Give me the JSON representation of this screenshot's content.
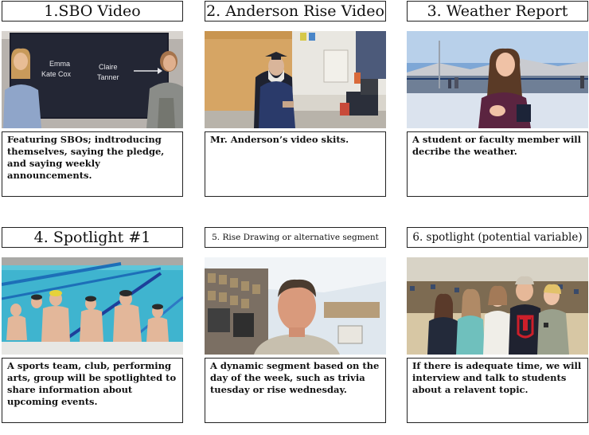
{
  "panels": [
    {
      "title": "1.SBO Video",
      "desc": "Featuring SBOs; indtroducing themselves,  saying the pledge, and saying weekly announcements.",
      "screen_text": [
        "Emma",
        "Kate Cox",
        "Claire",
        "Tanner"
      ]
    },
    {
      "title": "2. Anderson Rise Video",
      "desc": "Mr. Anderson’s video skits."
    },
    {
      "title": "3. Weather Report",
      "desc": "A student or faculty member will decribe the weather."
    },
    {
      "title": "4. Spotlight #1",
      "desc": "A sports team, club, performing arts, group will be spotlighted to share information about upcoming events."
    },
    {
      "title": "5. Rise Drawing or alternative segment",
      "desc": "A dynamic segment based on the day of the week, such as trivia tuesday or rise wednesday."
    },
    {
      "title": "6. spotlight (potential variable)",
      "desc": "If there is adequate time, we will interview and talk to students about a relavent topic."
    }
  ]
}
